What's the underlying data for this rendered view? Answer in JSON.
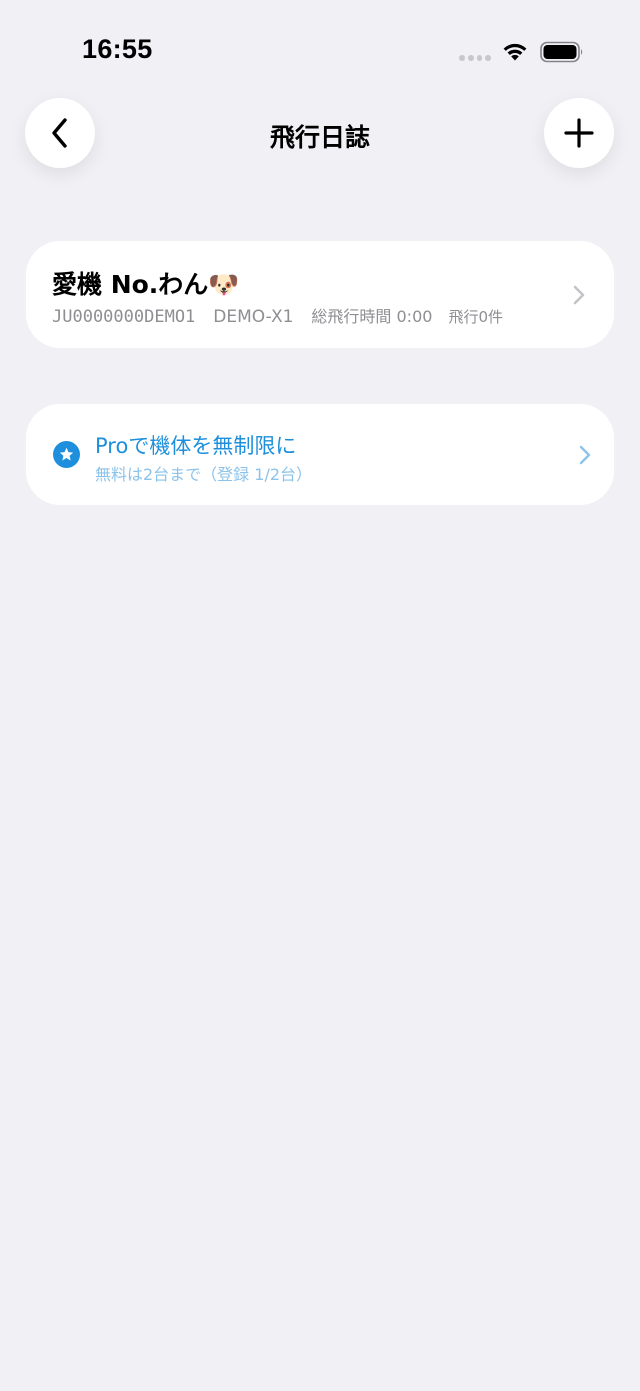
{
  "status_bar": {
    "time": "16:55"
  },
  "nav": {
    "title": "飛行日誌"
  },
  "aircraft": [
    {
      "name": "愛機 No.わん🐶",
      "registration": "JU0000000DEMO1",
      "model": "DEMO-X1",
      "total_flight_time": "総飛行時間 0:00",
      "flight_count": "飛行0件"
    }
  ],
  "pro_banner": {
    "title": "Proで機体を無制限に",
    "subtitle": "無料は2台まで（登録 1/2台）"
  },
  "colors": {
    "background": "#f0f0f5",
    "accent": "#1e8fdc",
    "accent_light": "#8cc3ea",
    "secondary_text": "#8e8e93"
  },
  "icons": {
    "back": "chevron-left-icon",
    "add": "plus-icon",
    "pro": "star-icon",
    "row": "chevron-right-icon"
  }
}
